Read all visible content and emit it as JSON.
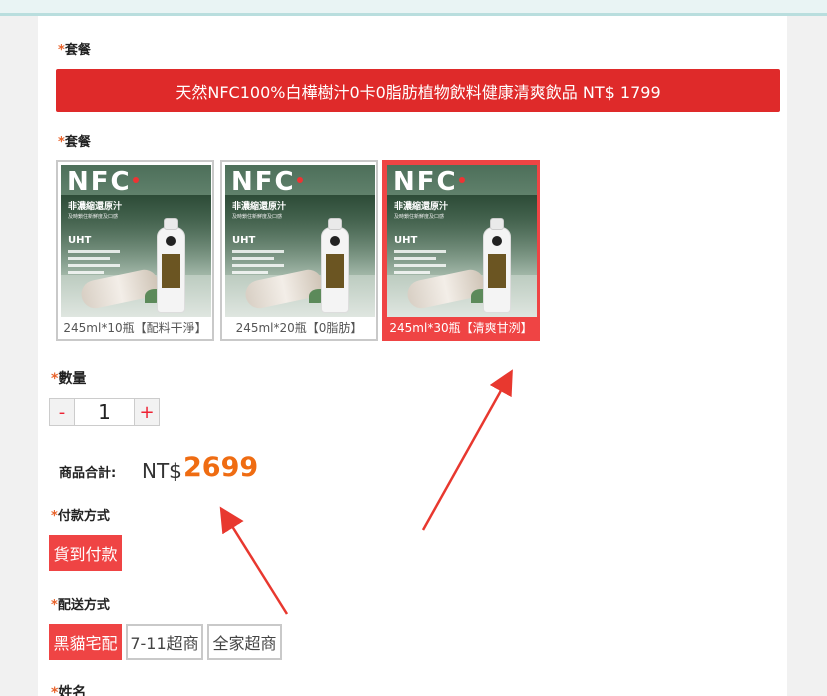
{
  "package_label_1": "套餐",
  "banner_text": "天然NFC100%白樺樹汁0卡0脂肪植物飲料健康清爽飲品 NT$ 1799",
  "package_label_2": "套餐",
  "product_image": {
    "brand": "NFC",
    "subtitle": "非濃縮還原汁",
    "tagline": "及時鎖住新鮮度及口感",
    "process": "UHT"
  },
  "options": [
    {
      "label": "245ml*10瓶【配料干淨】",
      "selected": false
    },
    {
      "label": "245ml*20瓶【0脂肪】",
      "selected": false
    },
    {
      "label": "245ml*30瓶【清爽甘洌】",
      "selected": true
    }
  ],
  "quantity": {
    "label": "數量",
    "minus": "-",
    "value": "1",
    "plus": "+"
  },
  "total": {
    "label": "商品合計:",
    "currency": "NT$",
    "amount": "2699"
  },
  "payment": {
    "label": "付款方式",
    "options": [
      {
        "label": "貨到付款",
        "selected": true
      }
    ]
  },
  "shipping": {
    "label": "配送方式",
    "options": [
      {
        "label": "黑貓宅配",
        "selected": true
      },
      {
        "label": "7-11超商",
        "selected": false
      },
      {
        "label": "全家超商",
        "selected": false
      }
    ]
  },
  "name_label": "姓名",
  "required_mark": "*",
  "colors": {
    "accent_red": "#ef4444",
    "banner_red": "#df2a2a",
    "price_orange": "#ef6c12",
    "arrow_red": "#e8382f"
  }
}
